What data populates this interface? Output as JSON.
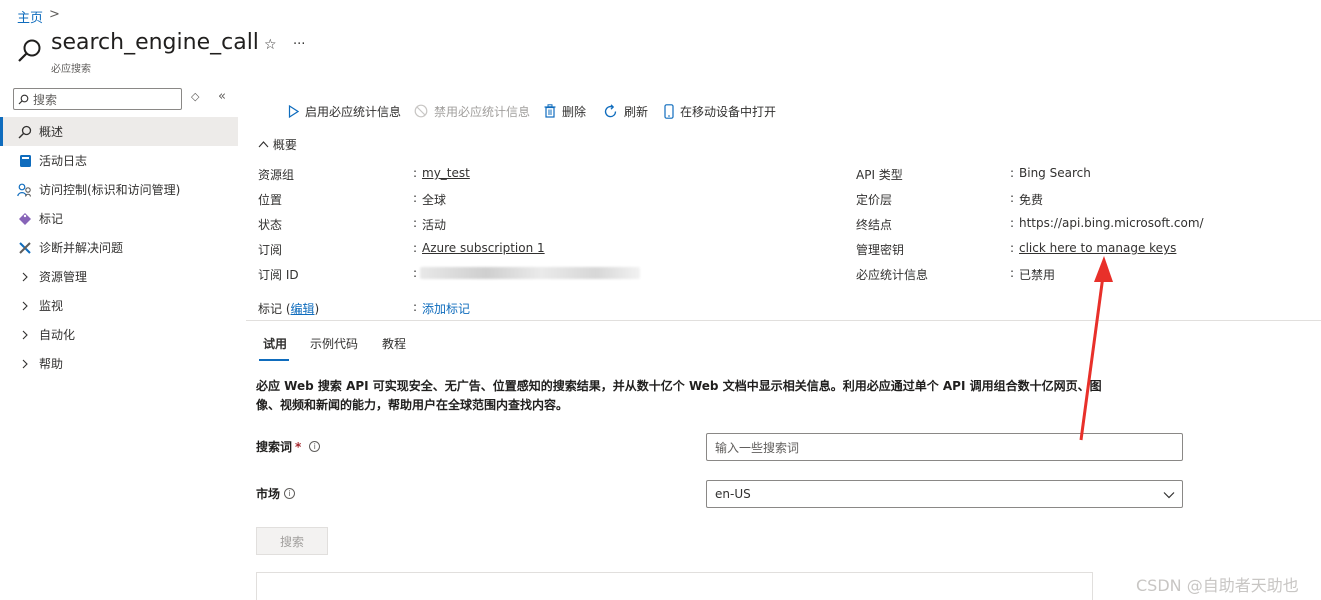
{
  "breadcrumb": {
    "home": "主页",
    "sep": ">"
  },
  "resource": {
    "title": "search_engine_call",
    "subtitle": "必应搜索",
    "star": "☆",
    "more": "···"
  },
  "sidebar": {
    "search_placeholder": "搜索",
    "sort_icon": "◇",
    "collapse_icon": "«",
    "items": [
      {
        "label": "概述",
        "icon": "search-icon"
      },
      {
        "label": "活动日志",
        "icon": "book-icon"
      },
      {
        "label": "访问控制(标识和访问管理)",
        "icon": "people-icon"
      },
      {
        "label": "标记",
        "icon": "tag-icon"
      },
      {
        "label": "诊断并解决问题",
        "icon": "wrench-icon"
      },
      {
        "label": "资源管理",
        "icon": "chevron-right-icon"
      },
      {
        "label": "监视",
        "icon": "chevron-right-icon"
      },
      {
        "label": "自动化",
        "icon": "chevron-right-icon"
      },
      {
        "label": "帮助",
        "icon": "chevron-right-icon"
      }
    ]
  },
  "toolbar": {
    "enable": "启用必应统计信息",
    "disable": "禁用必应统计信息",
    "delete": "删除",
    "refresh": "刷新",
    "mobile": "在移动设备中打开"
  },
  "essentials": {
    "toggle": "概要",
    "left": [
      {
        "label": "资源组",
        "value": "my_test",
        "link": true
      },
      {
        "label": "位置",
        "value": "全球",
        "link": false
      },
      {
        "label": "状态",
        "value": "活动",
        "link": false
      },
      {
        "label": "订阅",
        "value": "Azure subscription 1",
        "link": true
      },
      {
        "label": "订阅 ID",
        "value": "",
        "link": false
      }
    ],
    "right": [
      {
        "label": "API 类型",
        "value": "Bing Search",
        "link": false
      },
      {
        "label": "定价层",
        "value": "免费",
        "link": false
      },
      {
        "label": "终结点",
        "value": "https://api.bing.microsoft.com/",
        "link": false
      },
      {
        "label": "管理密钥",
        "value": "click here to manage keys",
        "link": true
      },
      {
        "label": "必应统计信息",
        "value": "已禁用",
        "link": false
      }
    ],
    "tags_label": "标记 (",
    "tags_edit": "编辑",
    "tags_close": ")",
    "tags_value": "添加标记",
    "colon": ":"
  },
  "tabs": [
    "试用",
    "示例代码",
    "教程"
  ],
  "description": "必应 Web 搜索 API 可实现安全、无广告、位置感知的搜索结果，并从数十亿个 Web 文档中显示相关信息。利用必应通过单个 API 调用组合数十亿网页、图像、视频和新闻的能力，帮助用户在全球范围内查找内容。",
  "form": {
    "query_label": "搜索词",
    "required_mark": "*",
    "query_placeholder": "输入一些搜索词",
    "market_label": "市场",
    "market_value": "en-US",
    "search_button": "搜索"
  },
  "watermark": "CSDN @自助者天助也",
  "colors": {
    "accent": "#0f6cbd",
    "annotation_arrow": "#e8302a"
  }
}
